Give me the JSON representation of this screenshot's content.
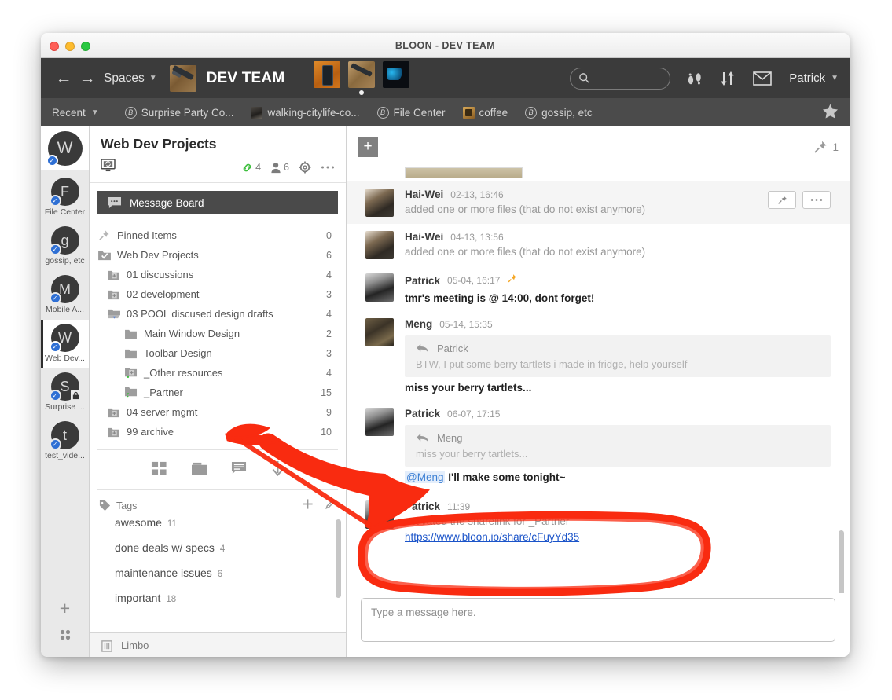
{
  "window": {
    "title": "BLOON - DEV TEAM"
  },
  "topnav": {
    "back_icon": "back-arrow-icon",
    "forward_icon": "forward-arrow-icon",
    "spaces_label": "Spaces",
    "space_name": "DEV TEAM",
    "search_placeholder": "",
    "search_value": "",
    "user_label": "Patrick",
    "icons": [
      "footprints-icon",
      "sort-arrows-icon",
      "envelope-icon"
    ]
  },
  "bookmarkbar": {
    "recent_label": "Recent",
    "items": [
      {
        "label": "Surprise Party Co...",
        "icon": "bloon-badge-icon"
      },
      {
        "label": "walking-citylife-co...",
        "icon": "thumbnail-city-icon"
      },
      {
        "label": "File Center",
        "icon": "bloon-badge-icon"
      },
      {
        "label": "coffee",
        "icon": "thumbnail-coffee-icon"
      },
      {
        "label": "gossip, etc",
        "icon": "bloon-badge-icon"
      }
    ],
    "star_icon": "star-icon"
  },
  "rail": {
    "current": {
      "initial": "W"
    },
    "items": [
      {
        "initial": "F",
        "label": "File Center",
        "locked": false
      },
      {
        "initial": "g",
        "label": "gossip, etc",
        "locked": false
      },
      {
        "initial": "M",
        "label": "Mobile A...",
        "locked": false
      },
      {
        "initial": "W",
        "label": "Web Dev...",
        "locked": false,
        "active": true
      },
      {
        "initial": "S",
        "label": "Surprise ...",
        "locked": true
      },
      {
        "initial": "t",
        "label": "test_vide...",
        "locked": false
      }
    ],
    "add_label": "+",
    "grid_icon": "grid-icon"
  },
  "center": {
    "project_title": "Web Dev Projects",
    "screen_icon": "monitor-share-icon",
    "link_count": "4",
    "member_count": "6",
    "gear_icon": "gear-icon",
    "more_icon": "more-icon",
    "message_board_label": "Message Board",
    "tree": [
      {
        "label": "Pinned Items",
        "count": "0",
        "indent": 0,
        "icon": "pin-icon"
      },
      {
        "label": "Web Dev Projects",
        "count": "6",
        "indent": 0,
        "icon": "folder-check-icon"
      },
      {
        "label": "01 discussions",
        "count": "4",
        "indent": 1,
        "icon": "folder-plus-icon"
      },
      {
        "label": "02 development",
        "count": "3",
        "indent": 1,
        "icon": "folder-plus-icon"
      },
      {
        "label": "03 POOL discused design drafts",
        "count": "4",
        "indent": 1,
        "icon": "folder-open-icon"
      },
      {
        "label": "Main Window Design",
        "count": "2",
        "indent": 2,
        "icon": "folder-icon"
      },
      {
        "label": "Toolbar Design",
        "count": "3",
        "indent": 2,
        "icon": "folder-icon"
      },
      {
        "label": "_Other resources",
        "count": "4",
        "indent": 2,
        "icon": "folder-plus-link-icon"
      },
      {
        "label": "_Partner",
        "count": "15",
        "indent": 2,
        "icon": "folder-link-icon"
      },
      {
        "label": "04 server mgmt",
        "count": "9",
        "indent": 1,
        "icon": "folder-plus-icon"
      },
      {
        "label": "99 archive",
        "count": "10",
        "indent": 1,
        "icon": "folder-plus-icon"
      }
    ],
    "tools": [
      "grid-view-icon",
      "folder-view-icon",
      "comment-view-icon",
      "download-icon"
    ],
    "tags_label": "Tags",
    "tags_add_icon": "plus-icon",
    "tags_edit_icon": "pencil-icon",
    "tags": [
      {
        "name": "awesome",
        "count": "11"
      },
      {
        "name": "done deals w/ specs",
        "count": "4"
      },
      {
        "name": "maintenance issues",
        "count": "6"
      },
      {
        "name": "important",
        "count": "18"
      }
    ],
    "limbo_label": "Limbo",
    "limbo_icon": "trash-icon"
  },
  "messages": {
    "add_label": "+",
    "pin_icon": "pin-icon",
    "pin_count": "1",
    "list": [
      {
        "author": "Hai-Wei",
        "time": "02-13, 16:46",
        "avatar": "haiwei",
        "text": "added one or more files (that do not exist anymore)",
        "highlighted": true,
        "actions": [
          "pin-icon",
          "more-icon"
        ]
      },
      {
        "author": "Hai-Wei",
        "time": "04-13, 13:56",
        "avatar": "haiwei",
        "text": "added one or more files (that do not exist anymore)"
      },
      {
        "author": "Patrick",
        "time": "05-04, 16:17",
        "avatar": "patrick",
        "pinned": true,
        "body": "tmr's meeting is @ 14:00, dont forget!"
      },
      {
        "author": "Meng",
        "time": "05-14, 15:35",
        "avatar": "meng",
        "quote_author": "Patrick",
        "quote_text": "BTW, I put some berry tartlets i made in fridge, help yourself",
        "body": "miss your berry tartlets..."
      },
      {
        "author": "Patrick",
        "time": "06-07, 17:15",
        "avatar": "patrick",
        "quote_author": "Meng",
        "quote_text": "miss your berry tartlets...",
        "mention": "@Meng",
        "body": "I'll make some tonight~"
      },
      {
        "author": "Patrick",
        "time": "11:39",
        "avatar": "patrick",
        "text": "activated the sharelink for  _Partner",
        "link": "https://www.bloon.io/share/cFuyYd35"
      }
    ],
    "composer_placeholder": "Type a message here."
  },
  "colors": {
    "topnav": "#3b3b3b",
    "bookmarkbar": "#4b4b4b",
    "accent_blue": "#2e6fd4",
    "link": "#1b54c9",
    "annotation": "#f92b10",
    "pin_orange": "#f5a623",
    "link_green": "#3fbf3f"
  }
}
